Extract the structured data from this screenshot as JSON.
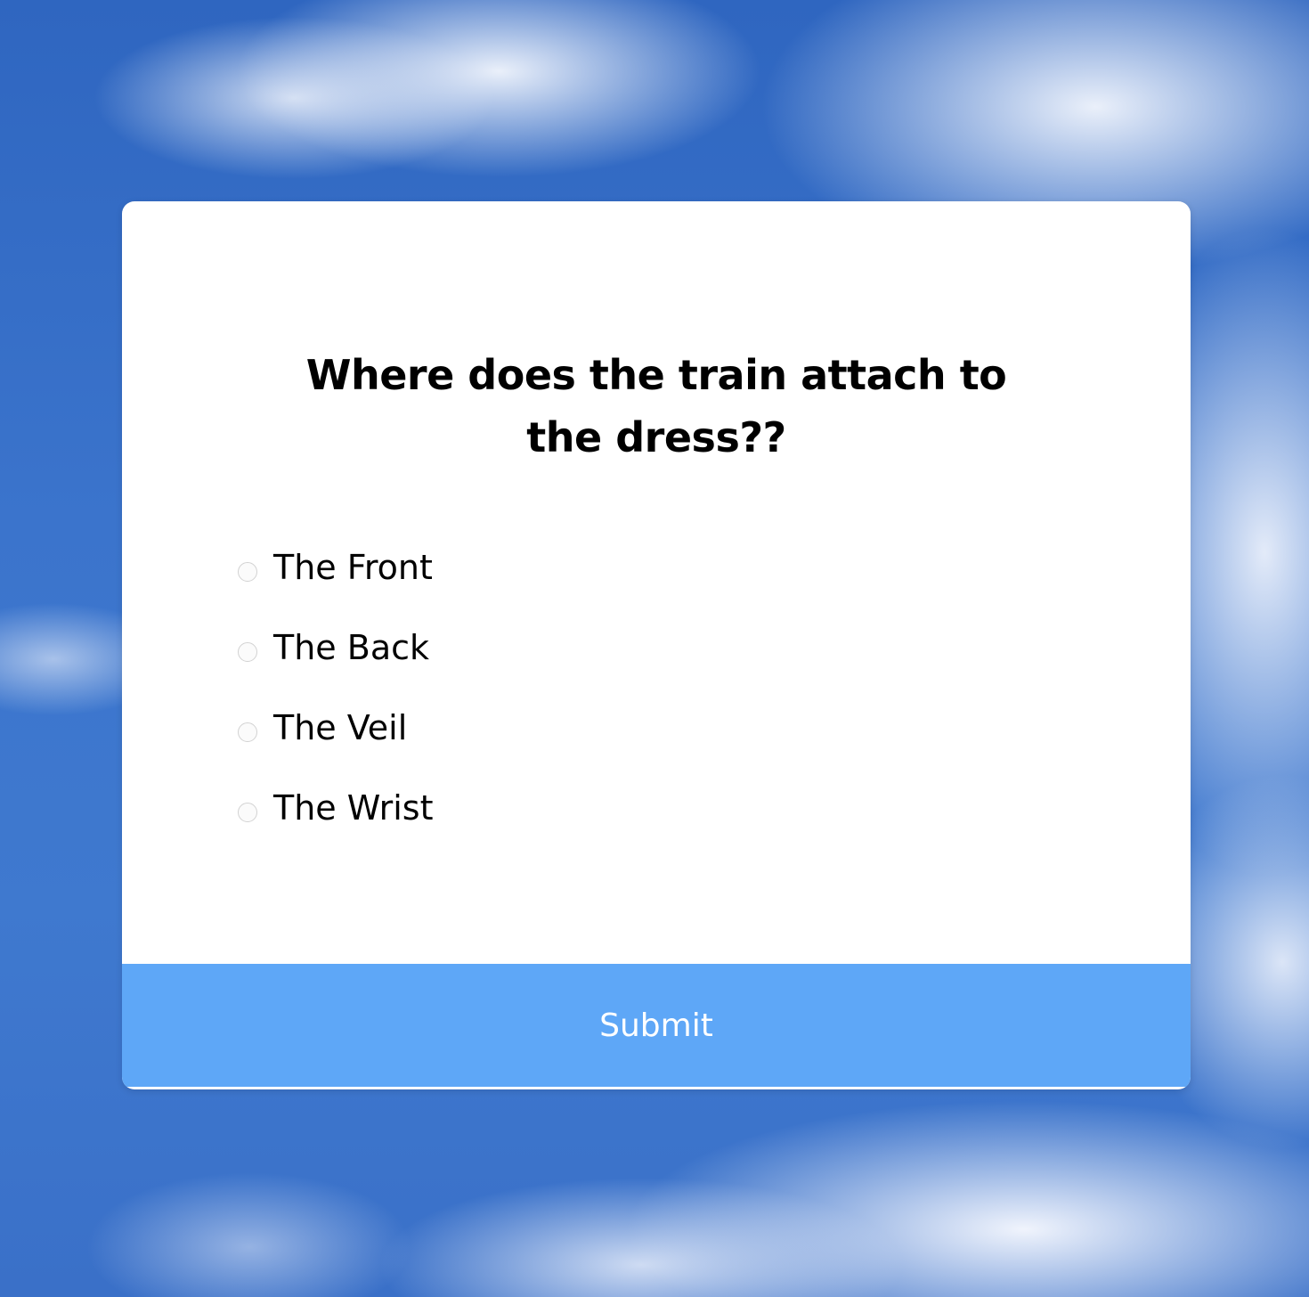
{
  "quiz": {
    "question": "Where does the train attach to the dress??",
    "options": [
      {
        "label": "The Front",
        "selected": false
      },
      {
        "label": "The Back",
        "selected": false
      },
      {
        "label": "The Veil",
        "selected": false
      },
      {
        "label": "The Wrist",
        "selected": false
      }
    ],
    "submit_label": "Submit"
  },
  "colors": {
    "submit_background": "#5ea7f7",
    "card_background": "#ffffff",
    "sky": "#3a70c8"
  }
}
